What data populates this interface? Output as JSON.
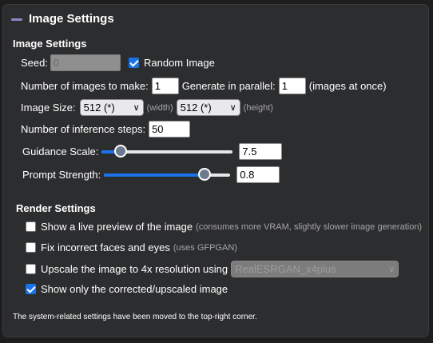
{
  "panel": {
    "title": "Image Settings"
  },
  "image_settings": {
    "title": "Image Settings",
    "seed": {
      "label": "Seed:",
      "value": "0"
    },
    "random_image": {
      "label": "Random Image",
      "checked": true
    },
    "num_images": {
      "label": "Number of images to make:",
      "value": "1"
    },
    "parallel": {
      "label": "Generate in parallel:",
      "value": "1",
      "suffix": "(images at once)"
    },
    "image_size": {
      "label": "Image Size:",
      "width": "512 (*)",
      "width_hint": "(width)",
      "height": "512 (*)",
      "height_hint": "(height)"
    },
    "inference_steps": {
      "label": "Number of inference steps:",
      "value": "50"
    },
    "guidance_scale": {
      "label": "Guidance Scale:",
      "value": "7.5",
      "level": 0.15
    },
    "prompt_strength": {
      "label": "Prompt Strength:",
      "value": "0.8",
      "level": 0.8
    }
  },
  "render_settings": {
    "title": "Render Settings",
    "live_preview": {
      "label": "Show a live preview of the image",
      "hint": "(consumes more VRAM, slightly slower image generation)",
      "checked": false
    },
    "fix_faces": {
      "label": "Fix incorrect faces and eyes",
      "hint": "(uses GFPGAN)",
      "checked": false
    },
    "upscale": {
      "label": "Upscale the image to 4x resolution using",
      "model": "RealESRGAN_x4plus",
      "checked": false
    },
    "only_corrected": {
      "label": "Show only the corrected/upscaled image",
      "checked": true
    }
  },
  "footer_note": "The system-related settings have been moved to the top-right corner."
}
